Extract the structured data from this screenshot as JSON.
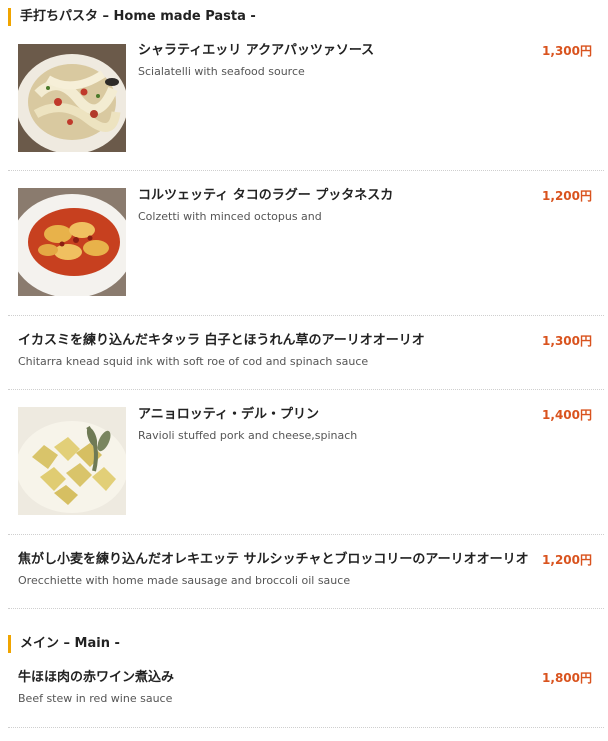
{
  "sections": [
    {
      "title": "手打ちパスタ – Home made Pasta -",
      "items": [
        {
          "name": "シャラティエッリ アクアパッツァソース",
          "desc": "Scialatelli with seafood source",
          "price": "1,300円",
          "image": "seafood-pasta-photo"
        },
        {
          "name": "コルツェッティ タコのラグー プッタネスカ",
          "desc": "Colzetti with minced octopus and",
          "price": "1,200円",
          "image": "octopus-ragu-pasta-photo"
        },
        {
          "name": "イカスミを練り込んだキタッラ 白子とほうれん草のアーリオオーリオ",
          "desc": "Chitarra knead squid ink with soft roe of cod and spinach sauce",
          "price": "1,300円"
        },
        {
          "name": "アニョロッティ・デル・プリン",
          "desc": "Ravioli stuffed pork and cheese,spinach",
          "price": "1,400円",
          "image": "ravioli-photo"
        },
        {
          "name": "焦がし小麦を練り込んだオレキエッテ サルシッチャとブロッコリーのアーリオオーリオ",
          "desc": "Orecchiette with home made sausage and broccoli oil sauce",
          "price": "1,200円"
        }
      ]
    },
    {
      "title": "メイン – Main -",
      "items": [
        {
          "name": "牛ほほ肉の赤ワイン煮込み",
          "desc": "Beef stew in red wine sauce",
          "price": "1,800円"
        }
      ]
    }
  ]
}
